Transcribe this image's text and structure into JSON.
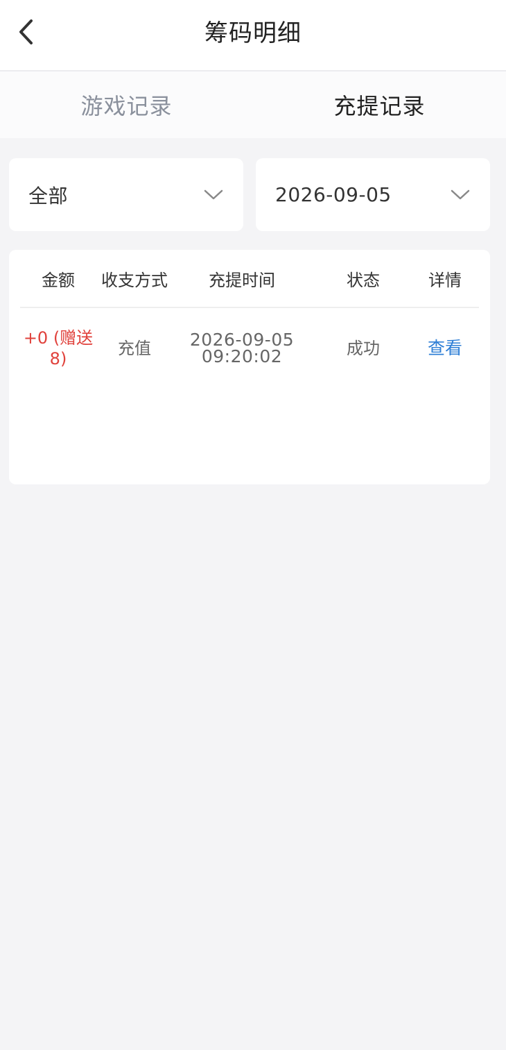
{
  "header": {
    "title": "筹码明细"
  },
  "tabs": [
    {
      "label": "游戏记录",
      "active": false
    },
    {
      "label": "充提记录",
      "active": true
    }
  ],
  "filters": {
    "type": "全部",
    "date": "2026-09-05"
  },
  "table": {
    "columns": [
      "金额",
      "收支方式",
      "充提时间",
      "状态",
      "详情"
    ],
    "rows": [
      {
        "amount": "+0 (赠送8)",
        "method": "充值",
        "date": "2026-09-05",
        "time": "09:20:02",
        "status": "成功",
        "detail": "查看"
      }
    ]
  },
  "colors": {
    "background": "#f4f4f6",
    "amount": "#e0413b",
    "link": "#2f7fd6",
    "inactive_tab": "#8a909c"
  },
  "icons": {
    "back": "chevron-left-icon",
    "dropdown": "chevron-down-icon"
  }
}
